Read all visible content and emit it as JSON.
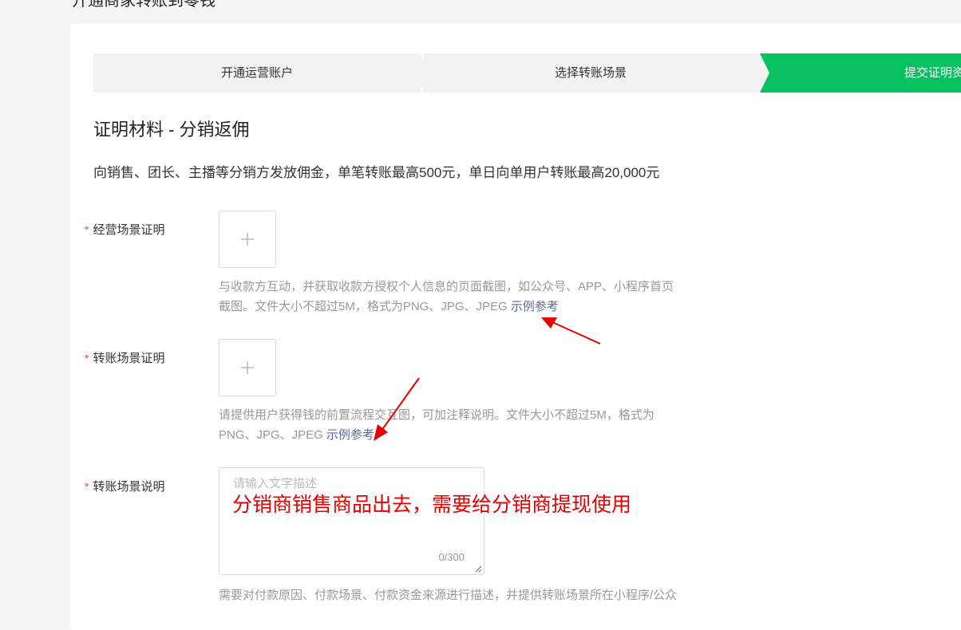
{
  "page": {
    "title": "开通商家转账到零钱"
  },
  "steps": [
    {
      "label": "开通运营账户",
      "active": false
    },
    {
      "label": "选择转账场景",
      "active": false
    },
    {
      "label": "提交证明资料",
      "active": true
    }
  ],
  "section": {
    "title": "证明材料 - 分销返佣",
    "description": "向销售、团长、主播等分销方发放佣金，单笔转账最高500元，单日向单用户转账最高20,000元"
  },
  "fields": {
    "business_proof": {
      "label": "经营场景证明",
      "hint_line1": "与收款方互动，并获取收款方授权个人信息的页面截图，如公众号、APP、小程序首页",
      "hint_line2": "截图。文件大小不超过5M，格式为PNG、JPG、JPEG",
      "example_link": "示例参考"
    },
    "transfer_proof": {
      "label": "转账场景证明",
      "hint_line1": "请提供用户获得钱的前置流程交互图，可加注释说明。文件大小不超过5M，格式为",
      "hint_line2": "PNG、JPG、JPEG",
      "example_link": "示例参考"
    },
    "transfer_desc": {
      "label": "转账场景说明",
      "placeholder": "请输入文字描述",
      "counter": "0/300",
      "hint_line1": "需要对付款原因、付款场景、付款资金来源进行描述，并提供转账场景所在小程序/公众"
    }
  },
  "annotation": {
    "text": "分销商销售商品出去，需要给分销商提现使用",
    "color": "#e60000"
  },
  "colors": {
    "accent": "#07c160",
    "link": "#576b95",
    "required": "#e34d4d"
  },
  "icons": {
    "upload": "plus-icon"
  }
}
